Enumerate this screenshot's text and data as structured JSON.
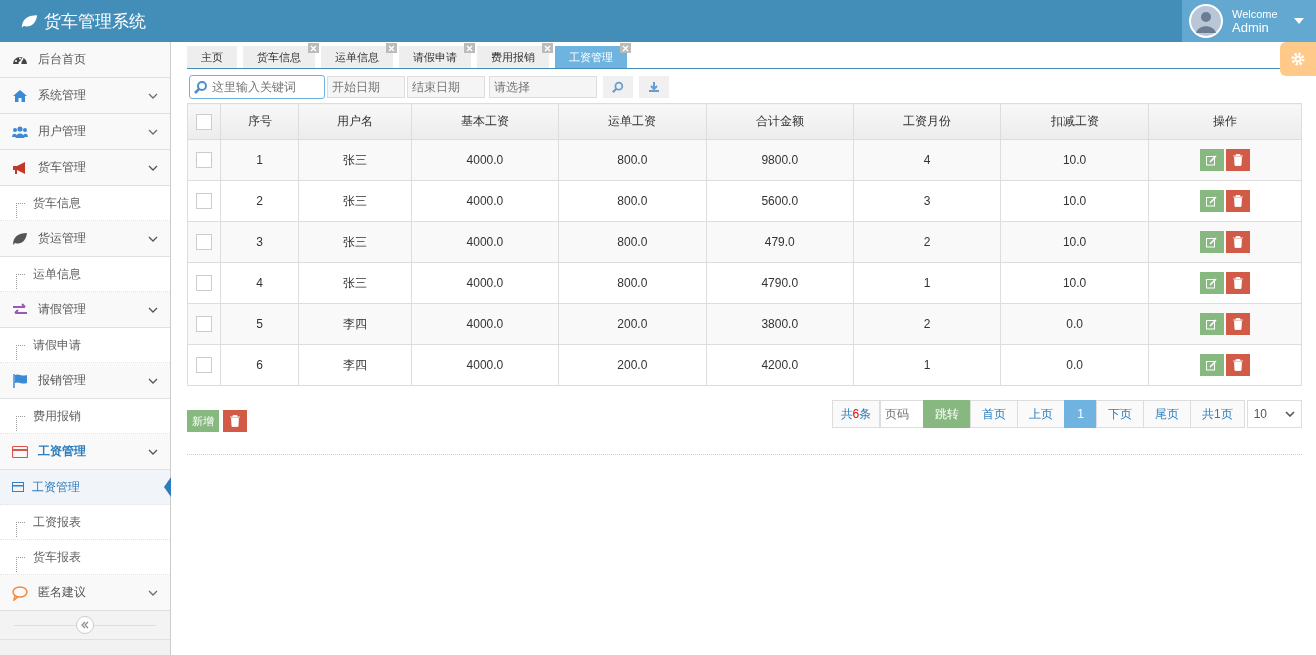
{
  "header": {
    "title": "货车管理系统",
    "user": {
      "greeting": "Welcome",
      "name": "Admin"
    }
  },
  "sidebar": {
    "items": [
      {
        "label": "后台首页",
        "selected": false,
        "has_arrow": false
      },
      {
        "label": "系统管理",
        "expanded": false,
        "selected": false,
        "has_arrow": true
      },
      {
        "label": "用户管理",
        "expanded": false,
        "selected": false,
        "has_arrow": true
      },
      {
        "label": "货车管理",
        "expanded": true,
        "selected": false,
        "has_arrow": true,
        "children": [
          {
            "label": "货车信息",
            "selected": false
          }
        ]
      },
      {
        "label": "货运管理",
        "expanded": true,
        "selected": false,
        "has_arrow": true,
        "children": [
          {
            "label": "运单信息",
            "selected": false
          }
        ]
      },
      {
        "label": "请假管理",
        "expanded": true,
        "selected": false,
        "has_arrow": true,
        "children": [
          {
            "label": "请假申请",
            "selected": false
          }
        ]
      },
      {
        "label": "报销管理",
        "expanded": true,
        "selected": false,
        "has_arrow": true,
        "children": [
          {
            "label": "费用报销",
            "selected": false
          }
        ]
      },
      {
        "label": "工资管理",
        "expanded": true,
        "selected": true,
        "has_arrow": true,
        "children": [
          {
            "label": "工资管理",
            "selected": true
          },
          {
            "label": "工资报表",
            "selected": false
          },
          {
            "label": "货车报表",
            "selected": false
          }
        ]
      },
      {
        "label": "匿名建议",
        "expanded": false,
        "selected": false,
        "has_arrow": true
      }
    ]
  },
  "tabs": [
    {
      "label": "主页",
      "selected": false,
      "closable": false
    },
    {
      "label": "货车信息",
      "selected": false,
      "closable": true
    },
    {
      "label": "运单信息",
      "selected": false,
      "closable": true
    },
    {
      "label": "请假申请",
      "selected": false,
      "closable": true
    },
    {
      "label": "费用报销",
      "selected": false,
      "closable": true
    },
    {
      "label": "工资管理",
      "selected": true,
      "closable": true
    }
  ],
  "filters": {
    "search": {
      "placeholder": "这里输入关键词"
    },
    "start_date": {
      "placeholder": "开始日期"
    },
    "end_date": {
      "placeholder": "结束日期"
    },
    "select": {
      "placeholder": "请选择"
    }
  },
  "table": {
    "header_checked": false,
    "columns": [
      "序号",
      "用户名",
      "基本工资",
      "运单工资",
      "合计金额",
      "工资月份",
      "扣减工资",
      "操作"
    ],
    "rows": [
      {
        "checked": false,
        "cells": [
          "1",
          "张三",
          "4000.0",
          "800.0",
          "9800.0",
          "4",
          "10.0"
        ]
      },
      {
        "checked": false,
        "cells": [
          "2",
          "张三",
          "4000.0",
          "800.0",
          "5600.0",
          "3",
          "10.0"
        ]
      },
      {
        "checked": false,
        "cells": [
          "3",
          "张三",
          "4000.0",
          "800.0",
          "479.0",
          "2",
          "10.0"
        ]
      },
      {
        "checked": false,
        "cells": [
          "4",
          "张三",
          "4000.0",
          "800.0",
          "4790.0",
          "1",
          "10.0"
        ]
      },
      {
        "checked": false,
        "cells": [
          "5",
          "李四",
          "4000.0",
          "200.0",
          "3800.0",
          "2",
          "0.0"
        ]
      },
      {
        "checked": false,
        "cells": [
          "6",
          "李四",
          "4000.0",
          "200.0",
          "4200.0",
          "1",
          "0.0"
        ]
      }
    ]
  },
  "actions": {
    "add": "新增"
  },
  "pagination": {
    "total_prefix": "共",
    "total_count": "6",
    "total_suffix": "条",
    "page_placeholder": "页码",
    "jump": "跳转",
    "first": "首页",
    "prev": "上页",
    "pages": [
      {
        "label": "1",
        "selected": true
      }
    ],
    "next": "下页",
    "last": "尾页",
    "page_count": "共1页",
    "page_size": "10"
  }
}
